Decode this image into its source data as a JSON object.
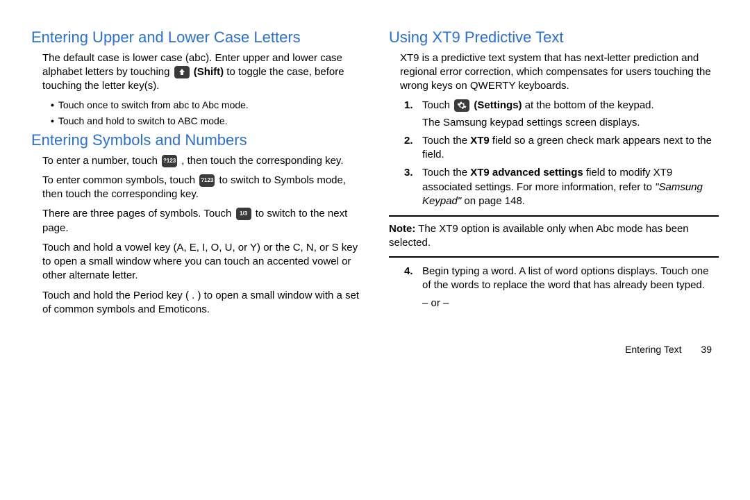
{
  "left": {
    "h1": "Entering Upper and Lower Case Letters",
    "p1a": "The default case is lower case (abc). Enter upper and lower case alphabet letters by touching ",
    "p1b_bold": "(Shift)",
    "p1c": " to toggle the case, before touching the letter key(s).",
    "b1": "Touch once to switch from abc to Abc mode.",
    "b2": "Touch and hold to switch to ABC mode.",
    "h2": "Entering Symbols and Numbers",
    "p2a": "To enter a number, touch ",
    "p2b": ", then touch the corresponding key.",
    "p3a": "To enter common symbols, touch ",
    "p3b": " to switch to Symbols mode, then touch the corresponding key.",
    "p4a": "There are three pages of symbols. Touch ",
    "p4b": " to switch to the next page.",
    "p5": "Touch and hold a vowel key (A, E, I, O, U, or Y) or the C, N, or S key to open a small window where you can touch an accented vowel or other alternate letter.",
    "p6": "Touch and hold the Period key ( . ) to open a small window with a set of common symbols and Emoticons.",
    "icon_123": "?123",
    "icon_13": "1/3"
  },
  "right": {
    "h1": "Using XT9 Predictive Text",
    "p1": "XT9 is a predictive text system that has next-letter prediction and regional error correction, which compensates for users touching the wrong keys on QWERTY keyboards.",
    "s1n": "1.",
    "s1a": "Touch ",
    "s1b_bold": "(Settings)",
    "s1c": " at the bottom of the keypad.",
    "s1d": "The Samsung keypad settings screen displays.",
    "s2n": "2.",
    "s2a": "Touch the ",
    "s2b_bold": "XT9",
    "s2c": " field so a green check mark appears next to the field.",
    "s3n": "3.",
    "s3a": "Touch the ",
    "s3b_bold": "XT9 advanced settings",
    "s3c": " field to modify XT9 associated settings. For more information, refer to ",
    "s3d_ital": "\"Samsung Keypad\"",
    "s3e": "  on page 148.",
    "note_label": "Note:",
    "note_body": " The XT9 option is available only when Abc mode has been selected.",
    "s4n": "4.",
    "s4a": "Begin typing a word. A list of word options displays. Touch one of the words to replace the word that has already been typed.",
    "s4or": "– or –"
  },
  "footer": {
    "section": "Entering Text",
    "page": "39"
  }
}
